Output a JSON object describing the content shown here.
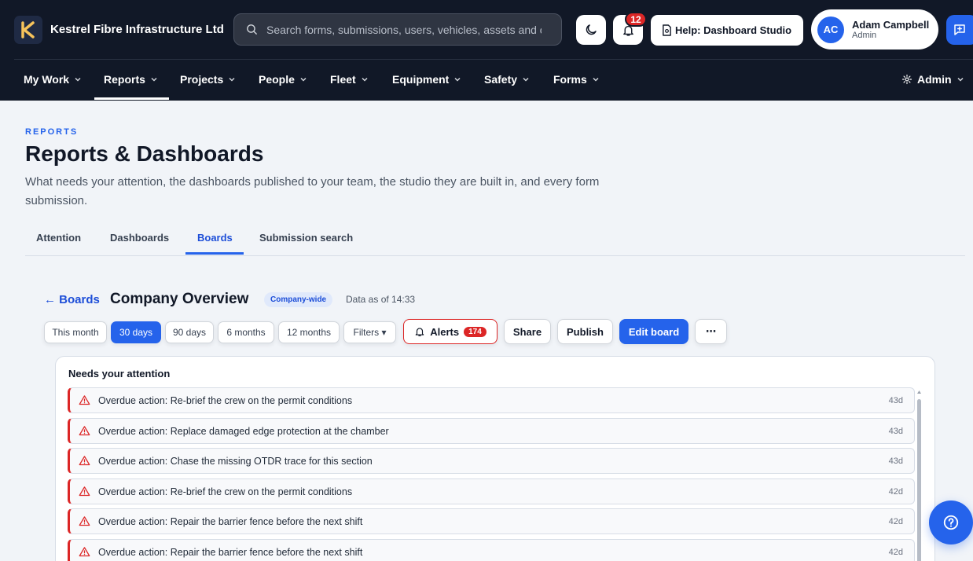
{
  "app": {
    "name": "Kestrel Fibre Infrastructure Ltd",
    "logo_letter": "K"
  },
  "search": {
    "placeholder": "Search forms, submissions, users, vehicles, assets and c"
  },
  "header": {
    "notification_count": "12",
    "help_label": "Help: Dashboard Studio",
    "user": {
      "initials": "AC",
      "name": "Adam Campbell",
      "role": "Admin"
    }
  },
  "nav": {
    "items": [
      {
        "label": "My Work"
      },
      {
        "label": "Reports"
      },
      {
        "label": "Projects"
      },
      {
        "label": "People"
      },
      {
        "label": "Fleet"
      },
      {
        "label": "Equipment"
      },
      {
        "label": "Safety"
      },
      {
        "label": "Forms"
      }
    ],
    "active": "Reports",
    "admin_label": "Admin"
  },
  "page": {
    "eyebrow": "REPORTS",
    "title": "Reports & Dashboards",
    "description": "What needs your attention, the dashboards published to your team, the studio they are built in, and every form submission."
  },
  "tabs": [
    {
      "label": "Attention"
    },
    {
      "label": "Dashboards"
    },
    {
      "label": "Boards"
    },
    {
      "label": "Submission search"
    }
  ],
  "active_tab": "Boards",
  "board": {
    "back_label": "← Boards",
    "title": "Company Overview",
    "scope": "Company-wide",
    "data_as_of": "Data as of 14:33"
  },
  "toolbar": {
    "ranges": [
      {
        "label": "This month"
      },
      {
        "label": "30 days"
      },
      {
        "label": "90 days"
      },
      {
        "label": "6 months"
      },
      {
        "label": "12 months"
      }
    ],
    "active_range": "30 days",
    "filters_label": "Filters ▾",
    "alerts_label": "Alerts",
    "alerts_count": "174",
    "share_label": "Share",
    "publish_label": "Publish",
    "edit_label": "Edit board",
    "more_label": "⋯"
  },
  "attention": {
    "title": "Needs your attention",
    "items": [
      {
        "text": "Overdue action: Re-brief the crew on the permit conditions",
        "age": "43d"
      },
      {
        "text": "Overdue action: Replace damaged edge protection at the chamber",
        "age": "43d"
      },
      {
        "text": "Overdue action: Chase the missing OTDR trace for this section",
        "age": "43d"
      },
      {
        "text": "Overdue action: Re-brief the crew on the permit conditions",
        "age": "42d"
      },
      {
        "text": "Overdue action: Repair the barrier fence before the next shift",
        "age": "42d"
      },
      {
        "text": "Overdue action: Repair the barrier fence before the next shift",
        "age": "42d"
      }
    ]
  },
  "colors": {
    "nav_background": "#111827",
    "accent": "#2563eb",
    "danger": "#dc2626",
    "page_background": "#f1f4f8"
  }
}
